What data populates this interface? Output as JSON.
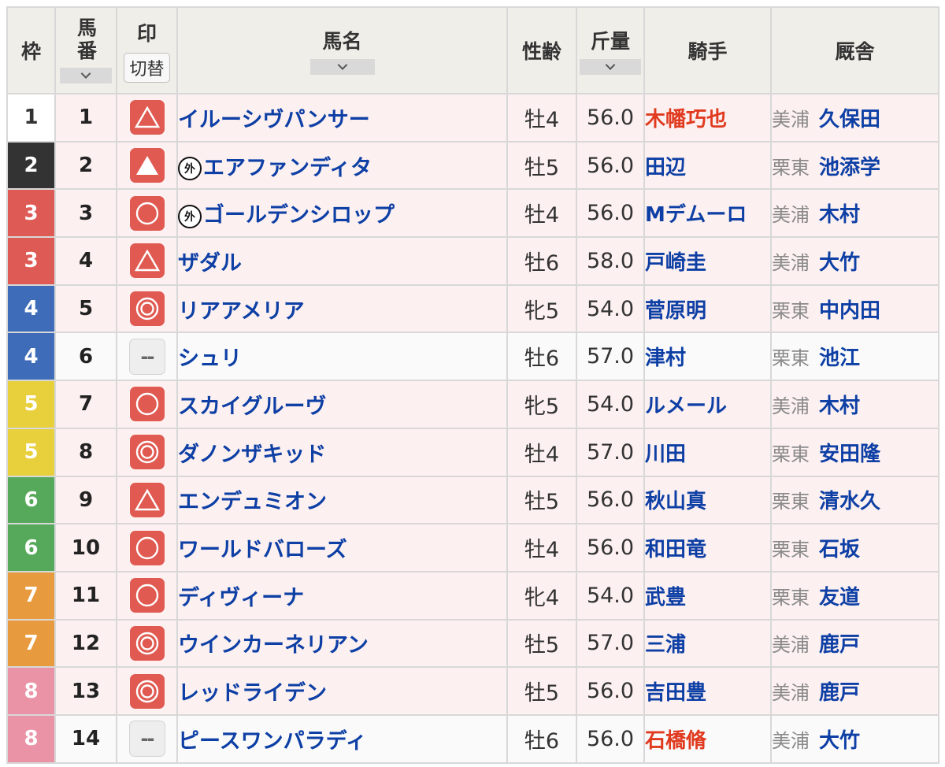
{
  "headers": {
    "waku": "枠",
    "umaban": "馬番",
    "mark": "印",
    "mark_toggle": "切替",
    "name": "馬名",
    "sex_age": "性齢",
    "weight": "斤量",
    "jockey": "騎手",
    "stable": "厩舎"
  },
  "external_badge": "外",
  "colors": {
    "frame1": "#ffffff",
    "frame2": "#333333",
    "frame3": "#de5a55",
    "frame4": "#3f6cb8",
    "frame5": "#e8cf3c",
    "frame6": "#56a95a",
    "frame7": "#e89a3e",
    "frame8": "#ea93a6",
    "mark_bg": "#e05a52",
    "horse_name": "#0d3fa5",
    "jockey_highlight": "#e03a1f"
  },
  "rows": [
    {
      "waku": "1",
      "umaban": "1",
      "mark": "triangle-outline",
      "name": "イルーシヴパンサー",
      "external": false,
      "sex_age": "牡4",
      "weight": "56.0",
      "jockey": "木幡巧也",
      "jockey_red": true,
      "region": "美浦",
      "trainer": "久保田",
      "bg": "pink"
    },
    {
      "waku": "2",
      "umaban": "2",
      "mark": "triangle-filled",
      "name": "エアファンディタ",
      "external": true,
      "sex_age": "牡5",
      "weight": "56.0",
      "jockey": "田辺",
      "jockey_red": false,
      "region": "栗東",
      "trainer": "池添学",
      "bg": "pink"
    },
    {
      "waku": "3",
      "umaban": "3",
      "mark": "circle",
      "name": "ゴールデンシロップ",
      "external": true,
      "sex_age": "牡4",
      "weight": "56.0",
      "jockey": "Mデムーロ",
      "jockey_red": false,
      "region": "美浦",
      "trainer": "木村",
      "bg": "pink"
    },
    {
      "waku": "3",
      "umaban": "4",
      "mark": "triangle-outline",
      "name": "ザダル",
      "external": false,
      "sex_age": "牡6",
      "weight": "58.0",
      "jockey": "戸崎圭",
      "jockey_red": false,
      "region": "美浦",
      "trainer": "大竹",
      "bg": "pink"
    },
    {
      "waku": "4",
      "umaban": "5",
      "mark": "double-circle",
      "name": "リアアメリア",
      "external": false,
      "sex_age": "牝5",
      "weight": "54.0",
      "jockey": "菅原明",
      "jockey_red": false,
      "region": "栗東",
      "trainer": "中内田",
      "bg": "pink"
    },
    {
      "waku": "4",
      "umaban": "6",
      "mark": "none",
      "name": "シュリ",
      "external": false,
      "sex_age": "牡6",
      "weight": "57.0",
      "jockey": "津村",
      "jockey_red": false,
      "region": "栗東",
      "trainer": "池江",
      "bg": "white"
    },
    {
      "waku": "5",
      "umaban": "7",
      "mark": "circle",
      "name": "スカイグルーヴ",
      "external": false,
      "sex_age": "牝5",
      "weight": "54.0",
      "jockey": "ルメール",
      "jockey_red": false,
      "region": "美浦",
      "trainer": "木村",
      "bg": "pink"
    },
    {
      "waku": "5",
      "umaban": "8",
      "mark": "double-circle",
      "name": "ダノンザキッド",
      "external": false,
      "sex_age": "牡4",
      "weight": "57.0",
      "jockey": "川田",
      "jockey_red": false,
      "region": "栗東",
      "trainer": "安田隆",
      "bg": "pink"
    },
    {
      "waku": "6",
      "umaban": "9",
      "mark": "triangle-outline",
      "name": "エンデュミオン",
      "external": false,
      "sex_age": "牡5",
      "weight": "56.0",
      "jockey": "秋山真",
      "jockey_red": false,
      "region": "栗東",
      "trainer": "清水久",
      "bg": "pink"
    },
    {
      "waku": "6",
      "umaban": "10",
      "mark": "circle",
      "name": "ワールドバローズ",
      "external": false,
      "sex_age": "牡4",
      "weight": "56.0",
      "jockey": "和田竜",
      "jockey_red": false,
      "region": "栗東",
      "trainer": "石坂",
      "bg": "pink"
    },
    {
      "waku": "7",
      "umaban": "11",
      "mark": "circle",
      "name": "ディヴィーナ",
      "external": false,
      "sex_age": "牝4",
      "weight": "54.0",
      "jockey": "武豊",
      "jockey_red": false,
      "region": "栗東",
      "trainer": "友道",
      "bg": "pink"
    },
    {
      "waku": "7",
      "umaban": "12",
      "mark": "double-circle",
      "name": "ウインカーネリアン",
      "external": false,
      "sex_age": "牡5",
      "weight": "57.0",
      "jockey": "三浦",
      "jockey_red": false,
      "region": "美浦",
      "trainer": "鹿戸",
      "bg": "pink"
    },
    {
      "waku": "8",
      "umaban": "13",
      "mark": "double-circle",
      "name": "レッドライデン",
      "external": false,
      "sex_age": "牡5",
      "weight": "56.0",
      "jockey": "吉田豊",
      "jockey_red": false,
      "region": "美浦",
      "trainer": "鹿戸",
      "bg": "pink"
    },
    {
      "waku": "8",
      "umaban": "14",
      "mark": "none",
      "name": "ピースワンパラディ",
      "external": false,
      "sex_age": "牡6",
      "weight": "56.0",
      "jockey": "石橋脩",
      "jockey_red": true,
      "region": "美浦",
      "trainer": "大竹",
      "bg": "white"
    }
  ],
  "no_mark_label": "--"
}
